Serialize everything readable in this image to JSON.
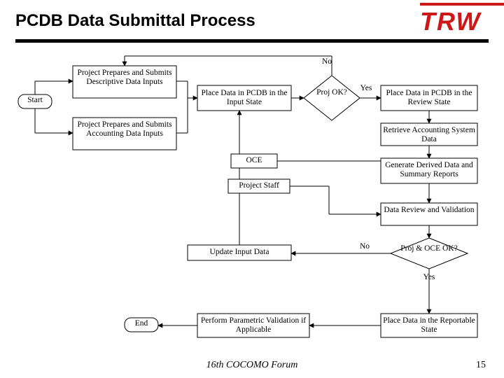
{
  "page": {
    "title": "PCDB Data Submittal Process",
    "footer": "16th COCOMO Forum",
    "page_number": "15",
    "logo_text": "TRW"
  },
  "nodes": {
    "start": "Start",
    "end": "End",
    "prep_desc": "Project Prepares and Submits Descriptive Data Inputs",
    "prep_acct": "Project Prepares and Submits Accounting Data Inputs",
    "input_state": "Place Data in PCDB in the Input State",
    "proj_ok": "Proj OK?",
    "review_state": "Place Data in PCDB in the Review State",
    "retrieve_acct": "Retrieve Accounting System Data",
    "derived": "Generate Derived Data and Summary Reports",
    "review_valid": "Data Review and Validation",
    "oce": "OCE",
    "proj_staff": "Project Staff",
    "proj_oce_ok": "Proj & OCE OK?",
    "update_input": "Update Input Data",
    "param_valid": "Perform Parametric Validation if Applicable",
    "reportable": "Place Data in the Reportable State"
  },
  "labels": {
    "yes1": "Yes",
    "no1": "No",
    "yes2": "Yes",
    "no2": "No"
  },
  "colors": {
    "accent": "#cc1818"
  }
}
